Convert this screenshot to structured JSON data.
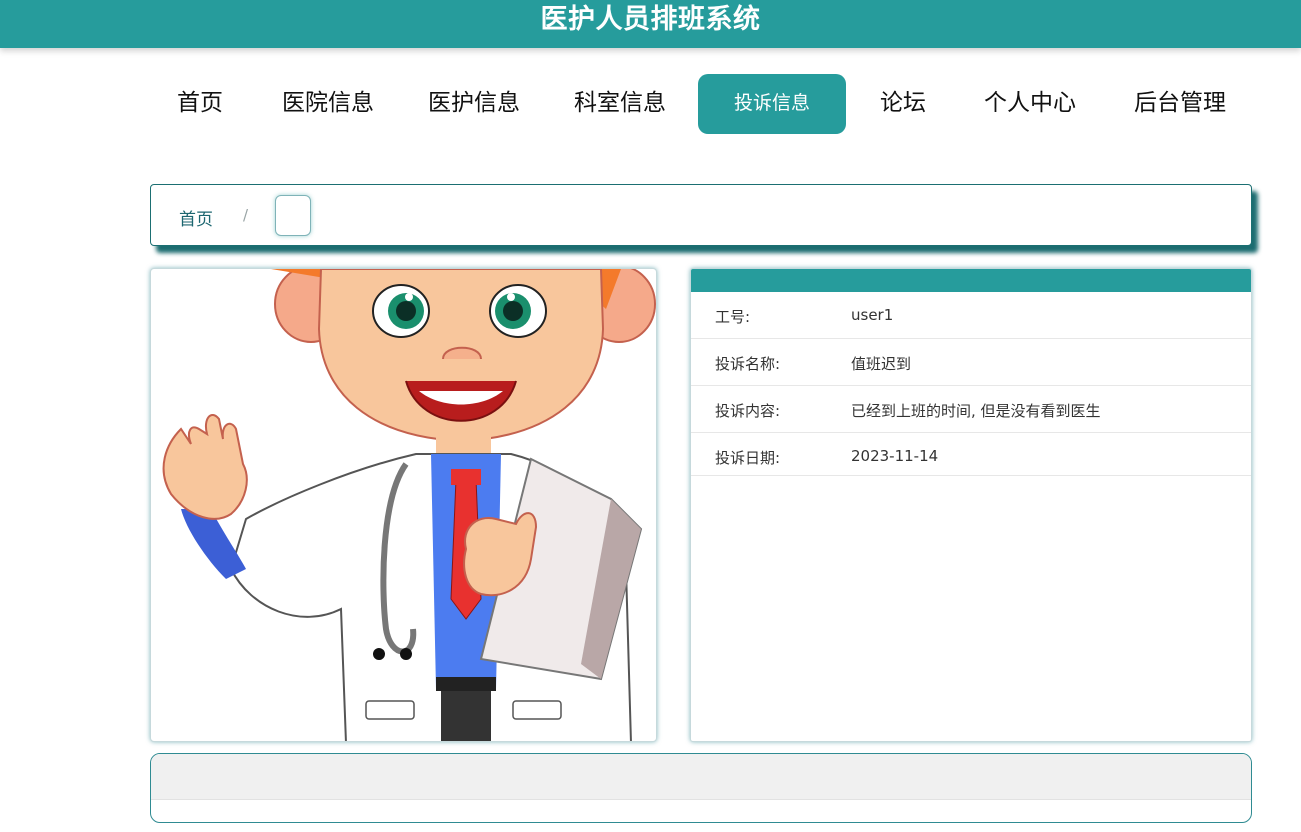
{
  "app": {
    "title": "医护人员排班系统"
  },
  "nav": {
    "items": [
      {
        "label": "首页",
        "active": false
      },
      {
        "label": "医院信息",
        "active": false
      },
      {
        "label": "医护信息",
        "active": false
      },
      {
        "label": "科室信息",
        "active": false
      },
      {
        "label": "投诉信息",
        "active": true
      },
      {
        "label": "论坛",
        "active": false
      },
      {
        "label": "个人中心",
        "active": false
      },
      {
        "label": "后台管理",
        "active": false
      }
    ]
  },
  "breadcrumb": {
    "home": "首页",
    "separator": "/",
    "current": ""
  },
  "detail": {
    "rows": [
      {
        "label": "工号:",
        "value": "user1"
      },
      {
        "label": "投诉名称:",
        "value": "值班迟到"
      },
      {
        "label": "投诉内容:",
        "value": "已经到上班的时间, 但是没有看到医生"
      },
      {
        "label": "投诉日期:",
        "value": "2023-11-14"
      }
    ]
  },
  "colors": {
    "primary": "#269c9c",
    "breadcrumb_shadow": "#106468",
    "text": "#333333"
  },
  "image": {
    "icon": "doctor-cartoon-illustration"
  }
}
